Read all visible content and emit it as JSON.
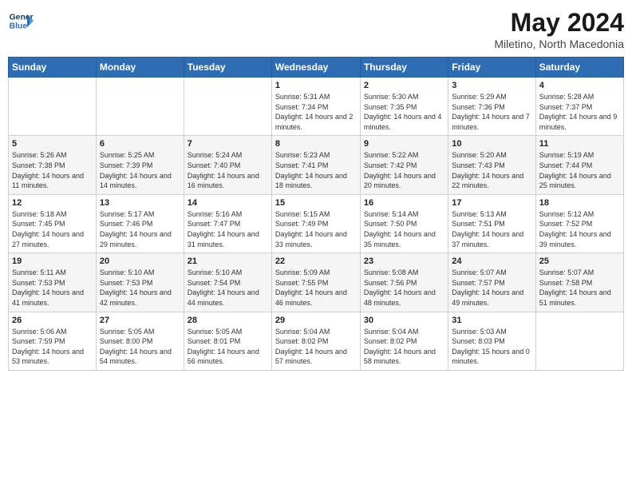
{
  "header": {
    "logo_line1": "General",
    "logo_line2": "Blue",
    "month_title": "May 2024",
    "location": "Miletino, North Macedonia"
  },
  "weekdays": [
    "Sunday",
    "Monday",
    "Tuesday",
    "Wednesday",
    "Thursday",
    "Friday",
    "Saturday"
  ],
  "weeks": [
    [
      {
        "day": "",
        "sunrise": "",
        "sunset": "",
        "daylight": ""
      },
      {
        "day": "",
        "sunrise": "",
        "sunset": "",
        "daylight": ""
      },
      {
        "day": "",
        "sunrise": "",
        "sunset": "",
        "daylight": ""
      },
      {
        "day": "1",
        "sunrise": "Sunrise: 5:31 AM",
        "sunset": "Sunset: 7:34 PM",
        "daylight": "Daylight: 14 hours and 2 minutes."
      },
      {
        "day": "2",
        "sunrise": "Sunrise: 5:30 AM",
        "sunset": "Sunset: 7:35 PM",
        "daylight": "Daylight: 14 hours and 4 minutes."
      },
      {
        "day": "3",
        "sunrise": "Sunrise: 5:29 AM",
        "sunset": "Sunset: 7:36 PM",
        "daylight": "Daylight: 14 hours and 7 minutes."
      },
      {
        "day": "4",
        "sunrise": "Sunrise: 5:28 AM",
        "sunset": "Sunset: 7:37 PM",
        "daylight": "Daylight: 14 hours and 9 minutes."
      }
    ],
    [
      {
        "day": "5",
        "sunrise": "Sunrise: 5:26 AM",
        "sunset": "Sunset: 7:38 PM",
        "daylight": "Daylight: 14 hours and 11 minutes."
      },
      {
        "day": "6",
        "sunrise": "Sunrise: 5:25 AM",
        "sunset": "Sunset: 7:39 PM",
        "daylight": "Daylight: 14 hours and 14 minutes."
      },
      {
        "day": "7",
        "sunrise": "Sunrise: 5:24 AM",
        "sunset": "Sunset: 7:40 PM",
        "daylight": "Daylight: 14 hours and 16 minutes."
      },
      {
        "day": "8",
        "sunrise": "Sunrise: 5:23 AM",
        "sunset": "Sunset: 7:41 PM",
        "daylight": "Daylight: 14 hours and 18 minutes."
      },
      {
        "day": "9",
        "sunrise": "Sunrise: 5:22 AM",
        "sunset": "Sunset: 7:42 PM",
        "daylight": "Daylight: 14 hours and 20 minutes."
      },
      {
        "day": "10",
        "sunrise": "Sunrise: 5:20 AM",
        "sunset": "Sunset: 7:43 PM",
        "daylight": "Daylight: 14 hours and 22 minutes."
      },
      {
        "day": "11",
        "sunrise": "Sunrise: 5:19 AM",
        "sunset": "Sunset: 7:44 PM",
        "daylight": "Daylight: 14 hours and 25 minutes."
      }
    ],
    [
      {
        "day": "12",
        "sunrise": "Sunrise: 5:18 AM",
        "sunset": "Sunset: 7:45 PM",
        "daylight": "Daylight: 14 hours and 27 minutes."
      },
      {
        "day": "13",
        "sunrise": "Sunrise: 5:17 AM",
        "sunset": "Sunset: 7:46 PM",
        "daylight": "Daylight: 14 hours and 29 minutes."
      },
      {
        "day": "14",
        "sunrise": "Sunrise: 5:16 AM",
        "sunset": "Sunset: 7:47 PM",
        "daylight": "Daylight: 14 hours and 31 minutes."
      },
      {
        "day": "15",
        "sunrise": "Sunrise: 5:15 AM",
        "sunset": "Sunset: 7:49 PM",
        "daylight": "Daylight: 14 hours and 33 minutes."
      },
      {
        "day": "16",
        "sunrise": "Sunrise: 5:14 AM",
        "sunset": "Sunset: 7:50 PM",
        "daylight": "Daylight: 14 hours and 35 minutes."
      },
      {
        "day": "17",
        "sunrise": "Sunrise: 5:13 AM",
        "sunset": "Sunset: 7:51 PM",
        "daylight": "Daylight: 14 hours and 37 minutes."
      },
      {
        "day": "18",
        "sunrise": "Sunrise: 5:12 AM",
        "sunset": "Sunset: 7:52 PM",
        "daylight": "Daylight: 14 hours and 39 minutes."
      }
    ],
    [
      {
        "day": "19",
        "sunrise": "Sunrise: 5:11 AM",
        "sunset": "Sunset: 7:53 PM",
        "daylight": "Daylight: 14 hours and 41 minutes."
      },
      {
        "day": "20",
        "sunrise": "Sunrise: 5:10 AM",
        "sunset": "Sunset: 7:53 PM",
        "daylight": "Daylight: 14 hours and 42 minutes."
      },
      {
        "day": "21",
        "sunrise": "Sunrise: 5:10 AM",
        "sunset": "Sunset: 7:54 PM",
        "daylight": "Daylight: 14 hours and 44 minutes."
      },
      {
        "day": "22",
        "sunrise": "Sunrise: 5:09 AM",
        "sunset": "Sunset: 7:55 PM",
        "daylight": "Daylight: 14 hours and 46 minutes."
      },
      {
        "day": "23",
        "sunrise": "Sunrise: 5:08 AM",
        "sunset": "Sunset: 7:56 PM",
        "daylight": "Daylight: 14 hours and 48 minutes."
      },
      {
        "day": "24",
        "sunrise": "Sunrise: 5:07 AM",
        "sunset": "Sunset: 7:57 PM",
        "daylight": "Daylight: 14 hours and 49 minutes."
      },
      {
        "day": "25",
        "sunrise": "Sunrise: 5:07 AM",
        "sunset": "Sunset: 7:58 PM",
        "daylight": "Daylight: 14 hours and 51 minutes."
      }
    ],
    [
      {
        "day": "26",
        "sunrise": "Sunrise: 5:06 AM",
        "sunset": "Sunset: 7:59 PM",
        "daylight": "Daylight: 14 hours and 53 minutes."
      },
      {
        "day": "27",
        "sunrise": "Sunrise: 5:05 AM",
        "sunset": "Sunset: 8:00 PM",
        "daylight": "Daylight: 14 hours and 54 minutes."
      },
      {
        "day": "28",
        "sunrise": "Sunrise: 5:05 AM",
        "sunset": "Sunset: 8:01 PM",
        "daylight": "Daylight: 14 hours and 56 minutes."
      },
      {
        "day": "29",
        "sunrise": "Sunrise: 5:04 AM",
        "sunset": "Sunset: 8:02 PM",
        "daylight": "Daylight: 14 hours and 57 minutes."
      },
      {
        "day": "30",
        "sunrise": "Sunrise: 5:04 AM",
        "sunset": "Sunset: 8:02 PM",
        "daylight": "Daylight: 14 hours and 58 minutes."
      },
      {
        "day": "31",
        "sunrise": "Sunrise: 5:03 AM",
        "sunset": "Sunset: 8:03 PM",
        "daylight": "Daylight: 15 hours and 0 minutes."
      },
      {
        "day": "",
        "sunrise": "",
        "sunset": "",
        "daylight": ""
      }
    ]
  ]
}
